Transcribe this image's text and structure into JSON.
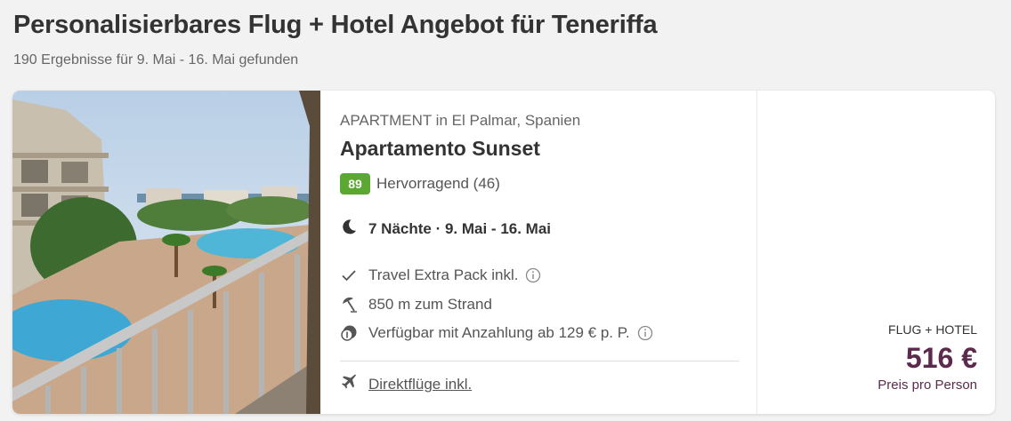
{
  "header": {
    "title": "Personalisierbares Flug + Hotel Angebot für Teneriffa",
    "subtitle": "190 Ergebnisse für 9. Mai - 16. Mai gefunden"
  },
  "offer": {
    "type_location": "APARTMENT in El Palmar, Spanien",
    "name": "Apartamento Sunset",
    "rating_score": "89",
    "rating_text": "Hervorragend (46)",
    "stay": "7 Nächte · 9. Mai - 16. Mai",
    "features": [
      {
        "icon": "checkmark-icon",
        "text": "Travel Extra Pack inkl."
      },
      {
        "icon": "beach-umbrella-icon",
        "text": "850 m zum Strand"
      },
      {
        "icon": "deposit-coin-icon",
        "text": "Verfügbar mit Anzahlung ab 129 € p. P."
      }
    ],
    "flight_link": "Direktflüge inkl.",
    "price_label": "FLUG + HOTEL",
    "price": "516 €",
    "price_sub": "Preis pro Person"
  },
  "colors": {
    "rating_green": "#5aa832",
    "price_purple": "#5b2a4d"
  }
}
